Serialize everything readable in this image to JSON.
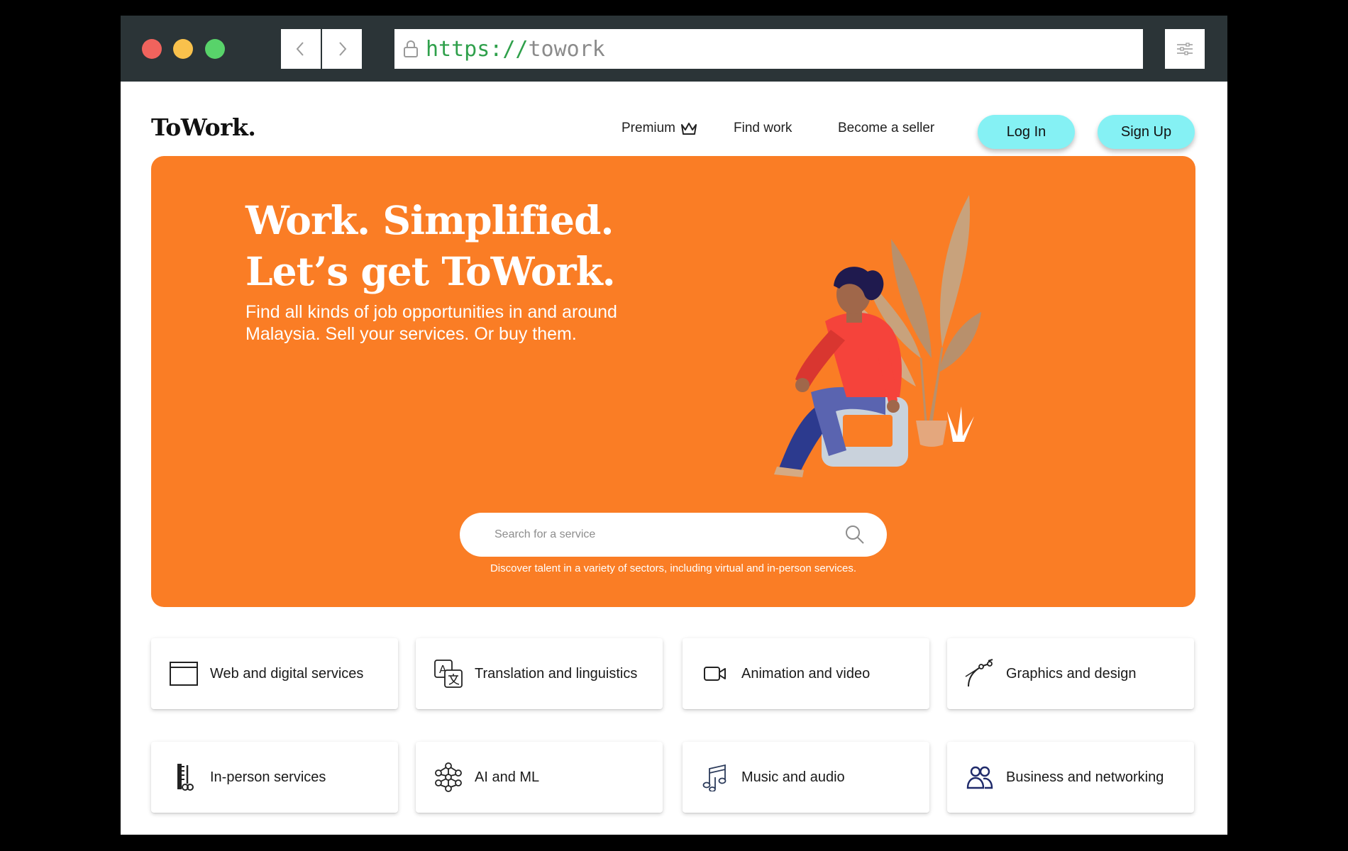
{
  "browser": {
    "url_scheme": "https://",
    "url_host": "towork"
  },
  "header": {
    "logo": "ToWork.",
    "nav": {
      "premium": "Premium",
      "find_work": "Find work",
      "become_seller": "Become a seller"
    },
    "login_label": "Log In",
    "signup_label": "Sign Up"
  },
  "hero": {
    "title_line1": "Work. Simplified.",
    "title_line2": "Let’s get ToWork.",
    "subtitle": "Find all kinds of job opportunities in and around Malaysia. Sell your services. Or buy them.",
    "search_placeholder": "Search for a service",
    "search_hint": "Discover talent in a variety of sectors, including virtual and in-person services."
  },
  "categories": [
    {
      "label": "Web and digital services",
      "icon": "browser-window-icon"
    },
    {
      "label": "Translation and linguistics",
      "icon": "translate-icon"
    },
    {
      "label": "Animation and video",
      "icon": "video-camera-icon"
    },
    {
      "label": "Graphics and design",
      "icon": "pen-tool-icon"
    },
    {
      "label": "In-person services",
      "icon": "comb-scissors-icon"
    },
    {
      "label": "AI and ML",
      "icon": "neural-network-icon"
    },
    {
      "label": "Music and audio",
      "icon": "music-notes-icon"
    },
    {
      "label": "Business and networking",
      "icon": "people-icon"
    }
  ],
  "colors": {
    "hero_bg": "#fa7d25",
    "button_bg": "#85f1f4",
    "titlebar": "#2b3437",
    "url_scheme": "#2fa04b"
  }
}
